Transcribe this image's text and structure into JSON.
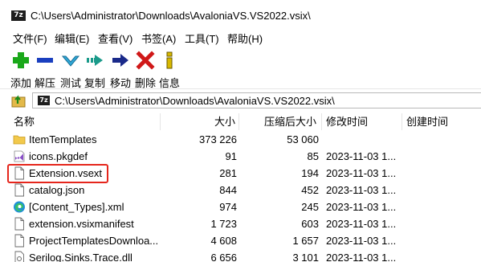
{
  "window": {
    "title": "C:\\Users\\Administrator\\Downloads\\AvaloniaVS.VS2022.vsix\\",
    "app_icon_text": "7z"
  },
  "menu": [
    {
      "label": "文件(F)"
    },
    {
      "label": "编辑(E)"
    },
    {
      "label": "查看(V)"
    },
    {
      "label": "书签(A)"
    },
    {
      "label": "工具(T)"
    },
    {
      "label": "帮助(H)"
    }
  ],
  "toolbar": [
    {
      "label": "添加",
      "icon": "plus-icon",
      "color": "#1aa81a"
    },
    {
      "label": "解压",
      "icon": "minus-icon",
      "color": "#1a3fbf"
    },
    {
      "label": "测试",
      "icon": "check-icon",
      "color": "#2fa8d8"
    },
    {
      "label": "复制",
      "icon": "copy-arrow-icon",
      "color": "#1a9a8a"
    },
    {
      "label": "移动",
      "icon": "move-arrow-icon",
      "color": "#1a2a8a"
    },
    {
      "label": "删除",
      "icon": "delete-x-icon",
      "color": "#d01818"
    },
    {
      "label": "信息",
      "icon": "info-icon",
      "color": "#d8b800"
    }
  ],
  "address": {
    "path": "C:\\Users\\Administrator\\Downloads\\AvaloniaVS.VS2022.vsix\\"
  },
  "columns": {
    "name": "名称",
    "size": "大小",
    "packed": "压缩后大小",
    "modified": "修改时间",
    "created": "创建时间"
  },
  "files": [
    {
      "name": "ItemTemplates",
      "size": "373 226",
      "packed": "53 060",
      "modified": "",
      "icon": "folder-icon"
    },
    {
      "name": "icons.pkgdef",
      "size": "91",
      "packed": "85",
      "modified": "2023-11-03 1...",
      "icon": "vs-file-icon"
    },
    {
      "name": "Extension.vsext",
      "size": "281",
      "packed": "194",
      "modified": "2023-11-03 1...",
      "icon": "file-icon"
    },
    {
      "name": "catalog.json",
      "size": "844",
      "packed": "452",
      "modified": "2023-11-03 1...",
      "icon": "file-icon"
    },
    {
      "name": "[Content_Types].xml",
      "size": "974",
      "packed": "245",
      "modified": "2023-11-03 1...",
      "icon": "edge-icon"
    },
    {
      "name": "extension.vsixmanifest",
      "size": "1 723",
      "packed": "603",
      "modified": "2023-11-03 1...",
      "icon": "file-icon"
    },
    {
      "name": "ProjectTemplatesDownloa...",
      "size": "4 608",
      "packed": "1 657",
      "modified": "2023-11-03 1...",
      "icon": "file-icon"
    },
    {
      "name": "Serilog.Sinks.Trace.dll",
      "size": "6 656",
      "packed": "3 101",
      "modified": "2023-11-03 1...",
      "icon": "dll-file-icon"
    }
  ]
}
